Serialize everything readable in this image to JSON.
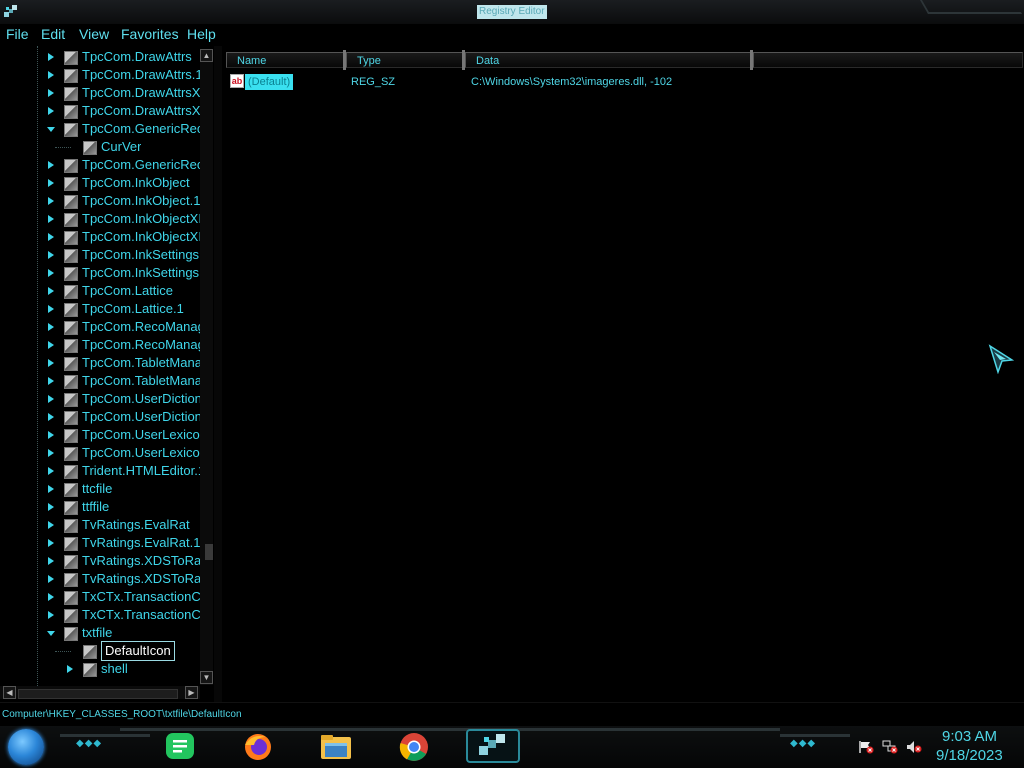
{
  "window": {
    "title": "Registry Editor"
  },
  "menu": [
    "File",
    "Edit",
    "View",
    "Favorites",
    "Help"
  ],
  "tree": {
    "rows": [
      {
        "label": "TpcCom.DrawAttrs",
        "expander": "closed",
        "level": 1
      },
      {
        "label": "TpcCom.DrawAttrs.1",
        "expander": "closed",
        "level": 1
      },
      {
        "label": "TpcCom.DrawAttrsX",
        "expander": "closed",
        "level": 1
      },
      {
        "label": "TpcCom.DrawAttrsX",
        "expander": "closed",
        "level": 1
      },
      {
        "label": "TpcCom.GenericRec",
        "expander": "open",
        "level": 1
      },
      {
        "label": "CurVer",
        "expander": "none",
        "level": 2
      },
      {
        "label": "TpcCom.GenericRec",
        "expander": "closed",
        "level": 1
      },
      {
        "label": "TpcCom.InkObject",
        "expander": "closed",
        "level": 1
      },
      {
        "label": "TpcCom.InkObject.1",
        "expander": "closed",
        "level": 1
      },
      {
        "label": "TpcCom.InkObjectXI",
        "expander": "closed",
        "level": 1
      },
      {
        "label": "TpcCom.InkObjectXI",
        "expander": "closed",
        "level": 1
      },
      {
        "label": "TpcCom.InkSettings",
        "expander": "closed",
        "level": 1
      },
      {
        "label": "TpcCom.InkSettings",
        "expander": "closed",
        "level": 1
      },
      {
        "label": "TpcCom.Lattice",
        "expander": "closed",
        "level": 1
      },
      {
        "label": "TpcCom.Lattice.1",
        "expander": "closed",
        "level": 1
      },
      {
        "label": "TpcCom.RecoManag",
        "expander": "closed",
        "level": 1
      },
      {
        "label": "TpcCom.RecoManag",
        "expander": "closed",
        "level": 1
      },
      {
        "label": "TpcCom.TabletMana",
        "expander": "closed",
        "level": 1
      },
      {
        "label": "TpcCom.TabletMana",
        "expander": "closed",
        "level": 1
      },
      {
        "label": "TpcCom.UserDiction",
        "expander": "closed",
        "level": 1
      },
      {
        "label": "TpcCom.UserDiction",
        "expander": "closed",
        "level": 1
      },
      {
        "label": "TpcCom.UserLexico",
        "expander": "closed",
        "level": 1
      },
      {
        "label": "TpcCom.UserLexico",
        "expander": "closed",
        "level": 1
      },
      {
        "label": "Trident.HTMLEditor.1",
        "expander": "closed",
        "level": 1
      },
      {
        "label": "ttcfile",
        "expander": "closed",
        "level": 1
      },
      {
        "label": "ttffile",
        "expander": "closed",
        "level": 1
      },
      {
        "label": "TvRatings.EvalRat",
        "expander": "closed",
        "level": 1
      },
      {
        "label": "TvRatings.EvalRat.1",
        "expander": "closed",
        "level": 1
      },
      {
        "label": "TvRatings.XDSToRat",
        "expander": "closed",
        "level": 1
      },
      {
        "label": "TvRatings.XDSToRat",
        "expander": "closed",
        "level": 1
      },
      {
        "label": "TxCTx.TransactionC",
        "expander": "closed",
        "level": 1
      },
      {
        "label": "TxCTx.TransactionC",
        "expander": "closed",
        "level": 1
      },
      {
        "label": "txtfile",
        "expander": "open",
        "level": 1
      },
      {
        "label": "DefaultIcon",
        "expander": "none",
        "level": 2,
        "selected": true
      },
      {
        "label": "shell",
        "expander": "closed",
        "level": 2
      }
    ]
  },
  "columns": [
    "Name",
    "Type",
    "Data"
  ],
  "values": [
    {
      "name": "(Default)",
      "type": "REG_SZ",
      "data": "C:\\Windows\\System32\\imageres.dll, -102",
      "icon": "string-value-icon"
    }
  ],
  "status": {
    "path": "Computer\\HKEY_CLASSES_ROOT\\txtfile\\DefaultIcon"
  },
  "taskbar": {
    "apps": [
      "notes-app-icon",
      "firefox-icon",
      "file-explorer-icon",
      "chrome-icon",
      "registry-editor-icon"
    ],
    "clock": {
      "time": "9:03 AM",
      "date": "9/18/2023"
    }
  }
}
